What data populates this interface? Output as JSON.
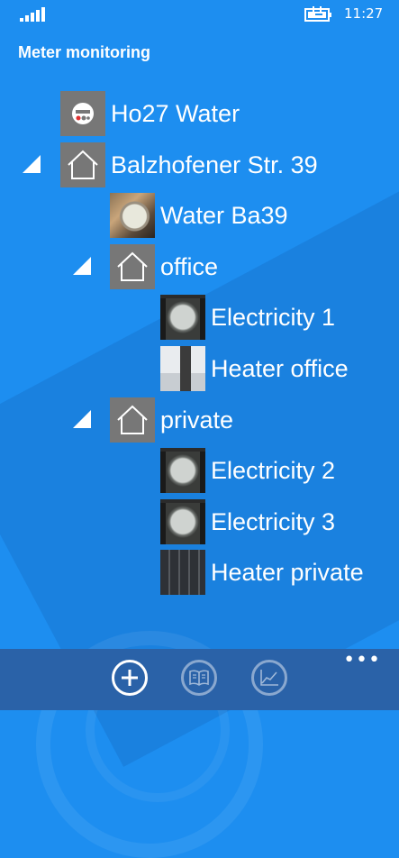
{
  "status_bar": {
    "time": "11:27",
    "signal_icon": "signal-bars-icon",
    "battery_icon": "battery-charging-icon"
  },
  "app": {
    "title": "Meter monitoring"
  },
  "tree": {
    "items": [
      {
        "label": "Ho27 Water",
        "icon": "meter-icon",
        "expanded": null
      },
      {
        "label": "Balzhofener Str. 39",
        "icon": "house-icon",
        "expanded": true
      },
      {
        "label": "Water Ba39",
        "icon": "water-meter-photo",
        "expanded": null
      },
      {
        "label": "office",
        "icon": "house-icon",
        "expanded": true
      },
      {
        "label": "Electricity 1",
        "icon": "electricity-meter-photo",
        "expanded": null
      },
      {
        "label": "Heater office",
        "icon": "heater-photo",
        "expanded": null
      },
      {
        "label": "private",
        "icon": "house-icon",
        "expanded": true
      },
      {
        "label": "Electricity 2",
        "icon": "electricity-meter-photo",
        "expanded": null
      },
      {
        "label": "Electricity 3",
        "icon": "electricity-meter-photo",
        "expanded": null
      },
      {
        "label": "Heater private",
        "icon": "heater-photo",
        "expanded": null
      }
    ]
  },
  "app_bar": {
    "buttons": [
      {
        "icon": "add-icon",
        "enabled": true
      },
      {
        "icon": "book-icon",
        "enabled": false
      },
      {
        "icon": "chart-icon",
        "enabled": false
      }
    ],
    "more_label": "•••"
  },
  "colors": {
    "background": "#1d8ef0",
    "app_bar": "#2a62a8",
    "thumb_placeholder": "#777777"
  }
}
